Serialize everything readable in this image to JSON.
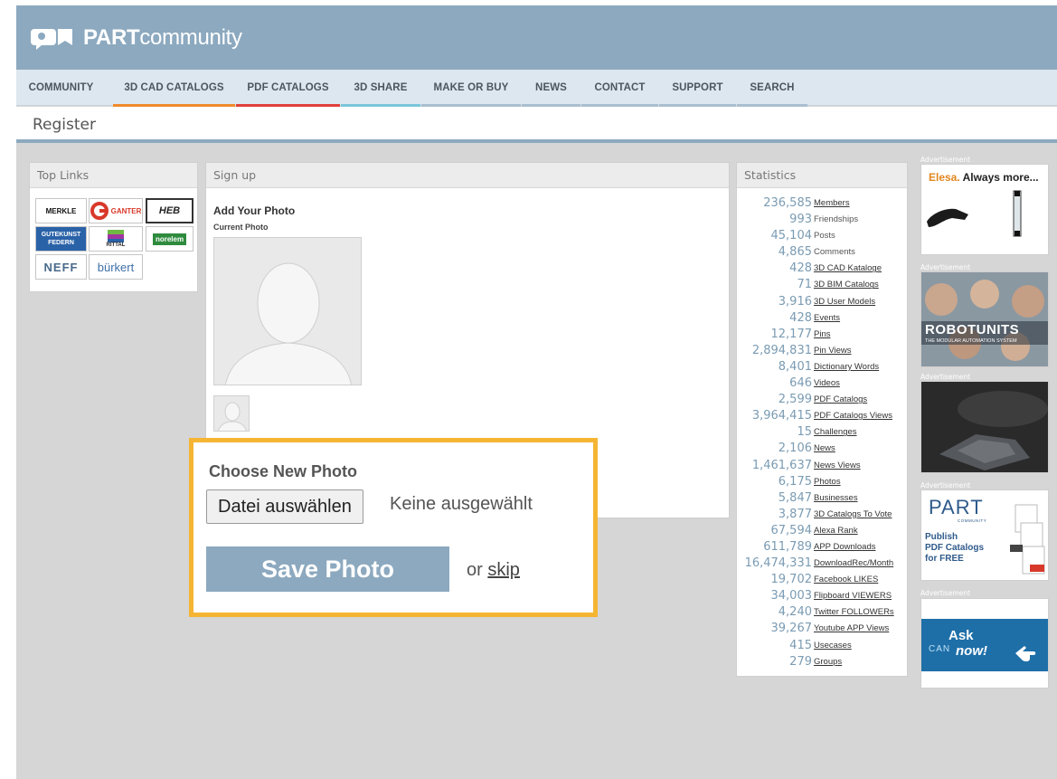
{
  "brand": {
    "bold": "PART",
    "light": "community"
  },
  "nav": [
    {
      "label": "COMMUNITY",
      "color": ""
    },
    {
      "label": "3D CAD CATALOGS",
      "color": "#ef8a2c"
    },
    {
      "label": "PDF CATALOGS",
      "color": "#e0403b"
    },
    {
      "label": "3D SHARE",
      "color": "#7bc6da"
    },
    {
      "label": "MAKE OR BUY",
      "color": "#a9bfd0"
    },
    {
      "label": "NEWS",
      "color": "#a9bfd0"
    },
    {
      "label": "CONTACT",
      "color": "#a9bfd0"
    },
    {
      "label": "SUPPORT",
      "color": "#a9bfd0"
    },
    {
      "label": "SEARCH",
      "color": "#a9bfd0"
    }
  ],
  "page_title": "Register",
  "top_links": {
    "title": "Top Links",
    "brands": [
      "MERKLE",
      "GANTER",
      "HEB",
      "GUTEKUNST FEDERN",
      "RITTAL",
      "norelem",
      "NEFF",
      "bürkert"
    ]
  },
  "signup": {
    "title": "Sign up",
    "add_photo": "Add Your Photo",
    "current_photo": "Current Photo",
    "choose_new_photo": "Choose New Photo",
    "file_button": "Datei auswählen",
    "file_status": "Keine ausgewählt",
    "save_button": "Save Photo",
    "or_text": "or",
    "skip_link": "skip"
  },
  "statistics": {
    "title": "Statistics",
    "rows": [
      {
        "value": "236,585",
        "label": "Members",
        "link": true
      },
      {
        "value": "993",
        "label": "Friendships",
        "link": false
      },
      {
        "value": "45,104",
        "label": "Posts",
        "link": false
      },
      {
        "value": "4,865",
        "label": "Comments",
        "link": false
      },
      {
        "value": "428",
        "label": "3D CAD Kataloge",
        "link": true
      },
      {
        "value": "71",
        "label": "3D BIM Catalogs",
        "link": true
      },
      {
        "value": "3,916",
        "label": "3D User Models",
        "link": true
      },
      {
        "value": "428",
        "label": "Events",
        "link": true
      },
      {
        "value": "12,177",
        "label": "Pins",
        "link": true
      },
      {
        "value": "2,894,831",
        "label": "Pin Views",
        "link": true
      },
      {
        "value": "8,401",
        "label": "Dictionary Words",
        "link": true
      },
      {
        "value": "646",
        "label": "Videos",
        "link": true
      },
      {
        "value": "2,599",
        "label": "PDF Catalogs",
        "link": true
      },
      {
        "value": "3,964,415",
        "label": "PDF Catalogs Views",
        "link": true
      },
      {
        "value": "15",
        "label": "Challenges",
        "link": true
      },
      {
        "value": "2,106",
        "label": "News",
        "link": true
      },
      {
        "value": "1,461,637",
        "label": "News Views",
        "link": true
      },
      {
        "value": "6,175",
        "label": "Photos",
        "link": true
      },
      {
        "value": "5,847",
        "label": "Businesses",
        "link": true
      },
      {
        "value": "3,877",
        "label": "3D Catalogs To Vote",
        "link": true
      },
      {
        "value": "67,594",
        "label": "Alexa Rank",
        "link": true
      },
      {
        "value": "611,789",
        "label": "APP Downloads",
        "link": true
      },
      {
        "value": "16,474,331",
        "label": "DownloadRec/Month",
        "link": true
      },
      {
        "value": "19,702",
        "label": "Facebook LIKES",
        "link": true
      },
      {
        "value": "34,003",
        "label": "Flipboard VIEWERS",
        "link": true
      },
      {
        "value": "4,240",
        "label": "Twitter FOLLOWERs",
        "link": true
      },
      {
        "value": "39,267",
        "label": "Youtube APP Views",
        "link": true
      },
      {
        "value": "415",
        "label": "Usecases",
        "link": true
      },
      {
        "value": "279",
        "label": "Groups",
        "link": true
      }
    ]
  },
  "ads": {
    "label": "Advertisement",
    "elesa": {
      "brand": "Elesa.",
      "tagline": "Always more..."
    },
    "robotunits": {
      "title": "ROBOTUNITS",
      "subtitle": "THE MODULAR AUTOMATION SYSTEM"
    },
    "part": {
      "logo": "PART",
      "sub": "COMMUNITY",
      "text1": "Publish",
      "text2": "PDF Catalogs",
      "text3": "for FREE"
    },
    "ask": {
      "line1": "Ask",
      "line2": "now!",
      "brand": "CAN"
    }
  }
}
